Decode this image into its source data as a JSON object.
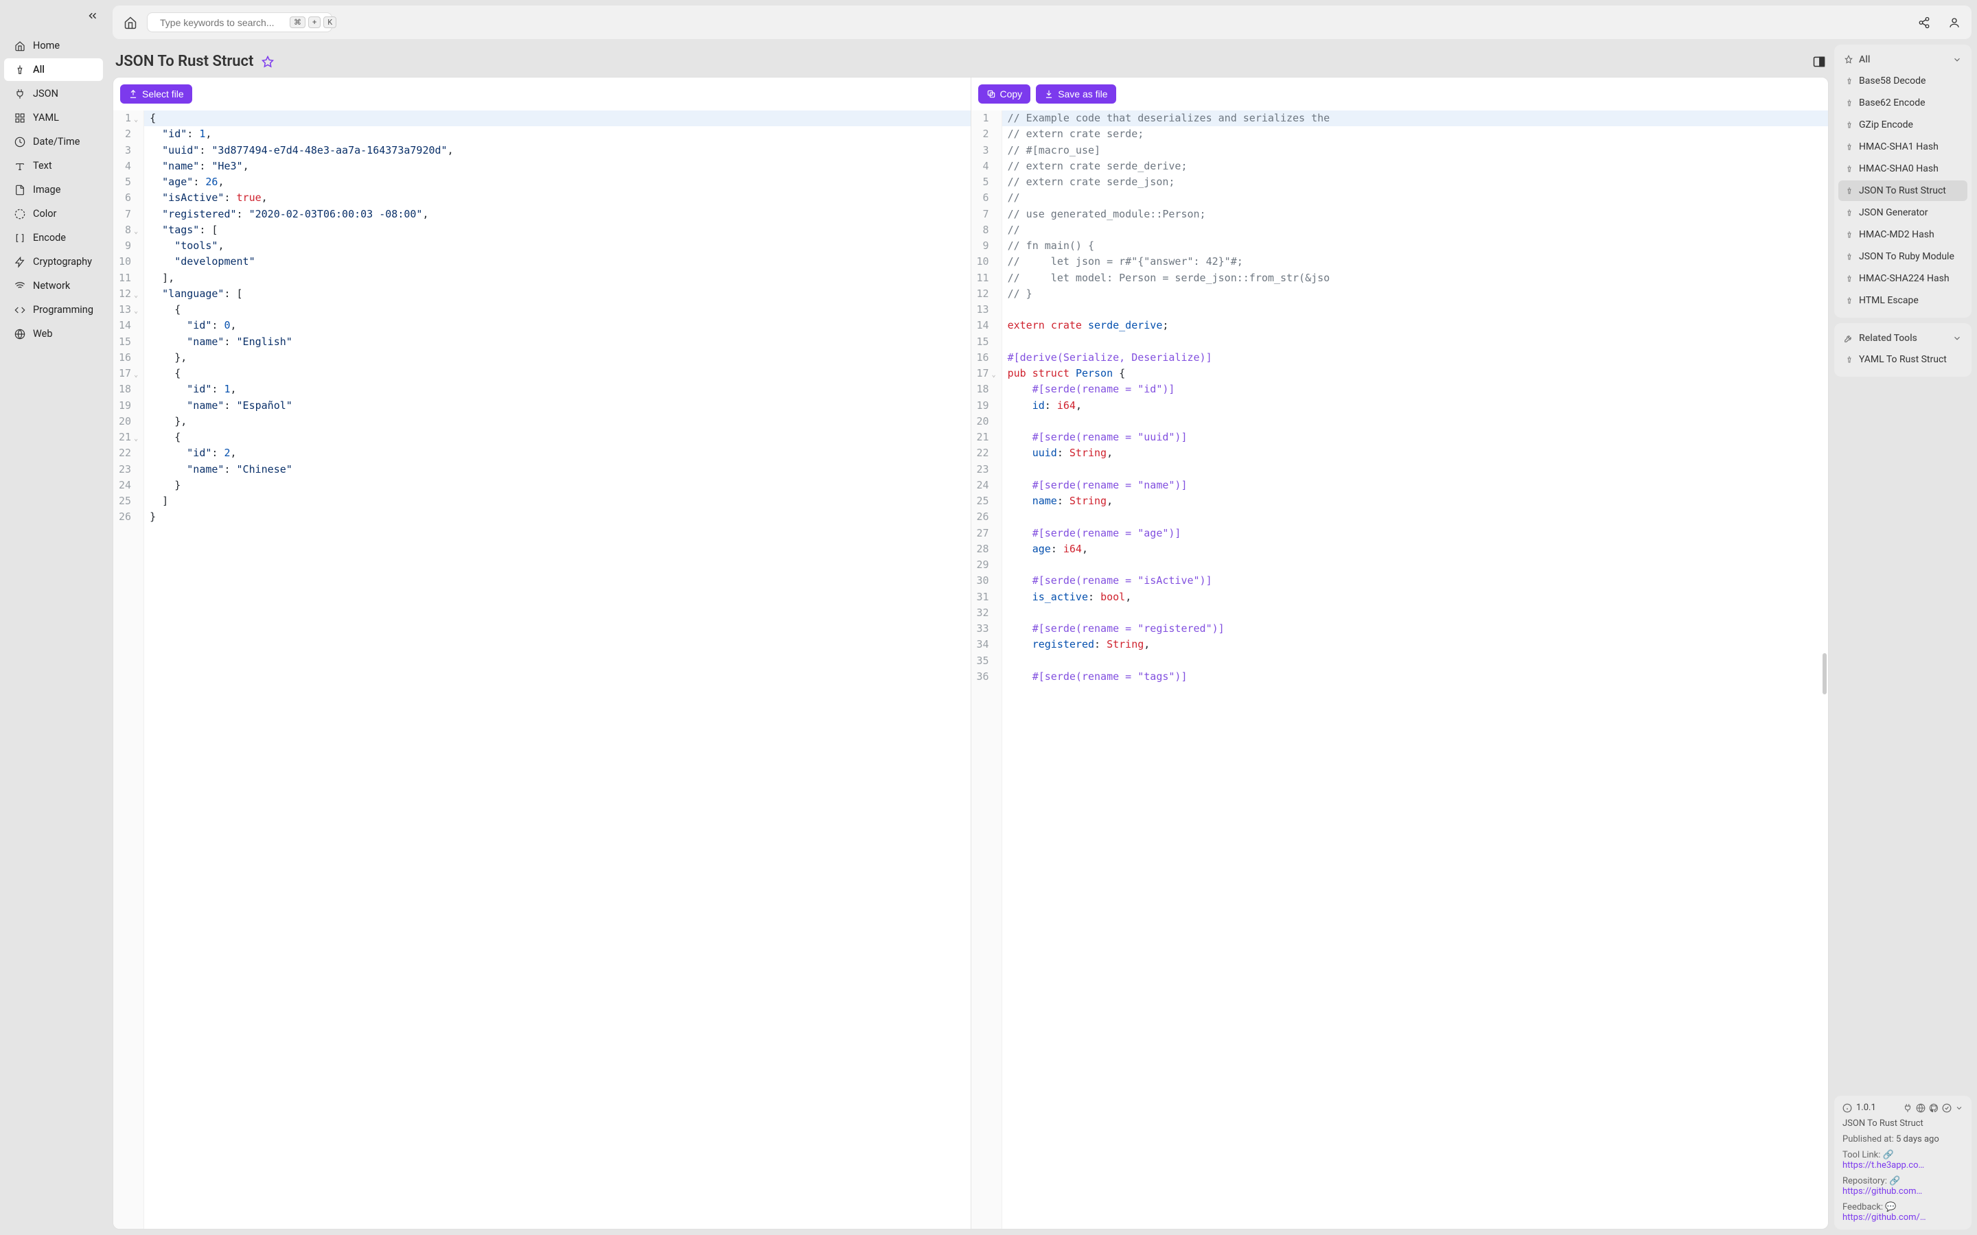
{
  "sidebar": {
    "items": [
      {
        "label": "Home",
        "icon": "home"
      },
      {
        "label": "All",
        "icon": "pin",
        "active": true
      },
      {
        "label": "JSON",
        "icon": "plug"
      },
      {
        "label": "YAML",
        "icon": "grid"
      },
      {
        "label": "Date/Time",
        "icon": "clock"
      },
      {
        "label": "Text",
        "icon": "text"
      },
      {
        "label": "Image",
        "icon": "file"
      },
      {
        "label": "Color",
        "icon": "circle-dash"
      },
      {
        "label": "Encode",
        "icon": "brackets"
      },
      {
        "label": "Cryptography",
        "icon": "bolt"
      },
      {
        "label": "Network",
        "icon": "wifi"
      },
      {
        "label": "Programming",
        "icon": "code"
      },
      {
        "label": "Web",
        "icon": "globe"
      }
    ]
  },
  "search": {
    "placeholder": "Type keywords to search...",
    "kbd1": "⌘",
    "kbdplus": "+",
    "kbd2": "K"
  },
  "page": {
    "title": "JSON To Rust Struct"
  },
  "actions": {
    "select_file": "Select file",
    "copy": "Copy",
    "save_as_file": "Save as file"
  },
  "input_json": {
    "lines": [
      {
        "n": 1,
        "fold": true,
        "tokens": [
          {
            "t": "{",
            "c": "punc"
          }
        ],
        "hl": true
      },
      {
        "n": 2,
        "tokens": [
          {
            "t": "  ",
            "c": ""
          },
          {
            "t": "\"id\"",
            "c": "key"
          },
          {
            "t": ": ",
            "c": "punc"
          },
          {
            "t": "1",
            "c": "num"
          },
          {
            "t": ",",
            "c": "punc"
          }
        ]
      },
      {
        "n": 3,
        "tokens": [
          {
            "t": "  ",
            "c": ""
          },
          {
            "t": "\"uuid\"",
            "c": "key"
          },
          {
            "t": ": ",
            "c": "punc"
          },
          {
            "t": "\"3d877494-e7d4-48e3-aa7a-164373a7920d\"",
            "c": "str"
          },
          {
            "t": ",",
            "c": "punc"
          }
        ]
      },
      {
        "n": 4,
        "tokens": [
          {
            "t": "  ",
            "c": ""
          },
          {
            "t": "\"name\"",
            "c": "key"
          },
          {
            "t": ": ",
            "c": "punc"
          },
          {
            "t": "\"He3\"",
            "c": "str"
          },
          {
            "t": ",",
            "c": "punc"
          }
        ]
      },
      {
        "n": 5,
        "tokens": [
          {
            "t": "  ",
            "c": ""
          },
          {
            "t": "\"age\"",
            "c": "key"
          },
          {
            "t": ": ",
            "c": "punc"
          },
          {
            "t": "26",
            "c": "num"
          },
          {
            "t": ",",
            "c": "punc"
          }
        ]
      },
      {
        "n": 6,
        "tokens": [
          {
            "t": "  ",
            "c": ""
          },
          {
            "t": "\"isActive\"",
            "c": "key"
          },
          {
            "t": ": ",
            "c": "punc"
          },
          {
            "t": "true",
            "c": "bool"
          },
          {
            "t": ",",
            "c": "punc"
          }
        ]
      },
      {
        "n": 7,
        "tokens": [
          {
            "t": "  ",
            "c": ""
          },
          {
            "t": "\"registered\"",
            "c": "key"
          },
          {
            "t": ": ",
            "c": "punc"
          },
          {
            "t": "\"2020-02-03T06:00:03 -08:00\"",
            "c": "str"
          },
          {
            "t": ",",
            "c": "punc"
          }
        ]
      },
      {
        "n": 8,
        "fold": true,
        "tokens": [
          {
            "t": "  ",
            "c": ""
          },
          {
            "t": "\"tags\"",
            "c": "key"
          },
          {
            "t": ": [",
            "c": "punc"
          }
        ]
      },
      {
        "n": 9,
        "tokens": [
          {
            "t": "    ",
            "c": ""
          },
          {
            "t": "\"tools\"",
            "c": "str"
          },
          {
            "t": ",",
            "c": "punc"
          }
        ]
      },
      {
        "n": 10,
        "tokens": [
          {
            "t": "    ",
            "c": ""
          },
          {
            "t": "\"development\"",
            "c": "str"
          }
        ]
      },
      {
        "n": 11,
        "tokens": [
          {
            "t": "  ],",
            "c": "punc"
          }
        ]
      },
      {
        "n": 12,
        "fold": true,
        "tokens": [
          {
            "t": "  ",
            "c": ""
          },
          {
            "t": "\"language\"",
            "c": "key"
          },
          {
            "t": ": [",
            "c": "punc"
          }
        ]
      },
      {
        "n": 13,
        "fold": true,
        "tokens": [
          {
            "t": "    {",
            "c": "punc"
          }
        ]
      },
      {
        "n": 14,
        "tokens": [
          {
            "t": "      ",
            "c": ""
          },
          {
            "t": "\"id\"",
            "c": "key"
          },
          {
            "t": ": ",
            "c": "punc"
          },
          {
            "t": "0",
            "c": "num"
          },
          {
            "t": ",",
            "c": "punc"
          }
        ]
      },
      {
        "n": 15,
        "tokens": [
          {
            "t": "      ",
            "c": ""
          },
          {
            "t": "\"name\"",
            "c": "key"
          },
          {
            "t": ": ",
            "c": "punc"
          },
          {
            "t": "\"English\"",
            "c": "str"
          }
        ]
      },
      {
        "n": 16,
        "tokens": [
          {
            "t": "    },",
            "c": "punc"
          }
        ]
      },
      {
        "n": 17,
        "fold": true,
        "tokens": [
          {
            "t": "    {",
            "c": "punc"
          }
        ]
      },
      {
        "n": 18,
        "tokens": [
          {
            "t": "      ",
            "c": ""
          },
          {
            "t": "\"id\"",
            "c": "key"
          },
          {
            "t": ": ",
            "c": "punc"
          },
          {
            "t": "1",
            "c": "num"
          },
          {
            "t": ",",
            "c": "punc"
          }
        ]
      },
      {
        "n": 19,
        "tokens": [
          {
            "t": "      ",
            "c": ""
          },
          {
            "t": "\"name\"",
            "c": "key"
          },
          {
            "t": ": ",
            "c": "punc"
          },
          {
            "t": "\"Español\"",
            "c": "str"
          }
        ]
      },
      {
        "n": 20,
        "tokens": [
          {
            "t": "    },",
            "c": "punc"
          }
        ]
      },
      {
        "n": 21,
        "fold": true,
        "tokens": [
          {
            "t": "    {",
            "c": "punc"
          }
        ]
      },
      {
        "n": 22,
        "tokens": [
          {
            "t": "      ",
            "c": ""
          },
          {
            "t": "\"id\"",
            "c": "key"
          },
          {
            "t": ": ",
            "c": "punc"
          },
          {
            "t": "2",
            "c": "num"
          },
          {
            "t": ",",
            "c": "punc"
          }
        ]
      },
      {
        "n": 23,
        "tokens": [
          {
            "t": "      ",
            "c": ""
          },
          {
            "t": "\"name\"",
            "c": "key"
          },
          {
            "t": ": ",
            "c": "punc"
          },
          {
            "t": "\"Chinese\"",
            "c": "str"
          }
        ]
      },
      {
        "n": 24,
        "tokens": [
          {
            "t": "    }",
            "c": "punc"
          }
        ]
      },
      {
        "n": 25,
        "tokens": [
          {
            "t": "  ]",
            "c": "punc"
          }
        ]
      },
      {
        "n": 26,
        "tokens": [
          {
            "t": "}",
            "c": "punc"
          }
        ],
        "hl2": true
      }
    ]
  },
  "output_rust": {
    "lines": [
      {
        "n": 1,
        "tokens": [
          {
            "t": "// Example code that deserializes and serializes the",
            "c": "comment"
          }
        ],
        "hl": true
      },
      {
        "n": 2,
        "tokens": [
          {
            "t": "// extern crate serde;",
            "c": "comment"
          }
        ]
      },
      {
        "n": 3,
        "tokens": [
          {
            "t": "// #[macro_use]",
            "c": "comment"
          }
        ]
      },
      {
        "n": 4,
        "tokens": [
          {
            "t": "// extern crate serde_derive;",
            "c": "comment"
          }
        ]
      },
      {
        "n": 5,
        "tokens": [
          {
            "t": "// extern crate serde_json;",
            "c": "comment"
          }
        ]
      },
      {
        "n": 6,
        "tokens": [
          {
            "t": "//",
            "c": "comment"
          }
        ]
      },
      {
        "n": 7,
        "tokens": [
          {
            "t": "// use generated_module::Person;",
            "c": "comment"
          }
        ]
      },
      {
        "n": 8,
        "tokens": [
          {
            "t": "//",
            "c": "comment"
          }
        ]
      },
      {
        "n": 9,
        "tokens": [
          {
            "t": "// fn main() {",
            "c": "comment"
          }
        ]
      },
      {
        "n": 10,
        "tokens": [
          {
            "t": "//     let json = r#\"{\"answer\": 42}\"#;",
            "c": "comment"
          }
        ]
      },
      {
        "n": 11,
        "tokens": [
          {
            "t": "//     let model: Person = serde_json::from_str(&jso",
            "c": "comment"
          }
        ]
      },
      {
        "n": 12,
        "tokens": [
          {
            "t": "// }",
            "c": "comment"
          }
        ]
      },
      {
        "n": 13,
        "tokens": [
          {
            "t": "",
            "c": ""
          }
        ]
      },
      {
        "n": 14,
        "tokens": [
          {
            "t": "extern",
            "c": "kw"
          },
          {
            "t": " ",
            "c": ""
          },
          {
            "t": "crate",
            "c": "kw"
          },
          {
            "t": " ",
            "c": ""
          },
          {
            "t": "serde_derive",
            "c": "ident"
          },
          {
            "t": ";",
            "c": "punc"
          }
        ]
      },
      {
        "n": 15,
        "tokens": [
          {
            "t": "",
            "c": ""
          }
        ]
      },
      {
        "n": 16,
        "tokens": [
          {
            "t": "#[derive(Serialize, Deserialize)]",
            "c": "kw2"
          }
        ]
      },
      {
        "n": 17,
        "fold": true,
        "tokens": [
          {
            "t": "pub",
            "c": "kw"
          },
          {
            "t": " ",
            "c": ""
          },
          {
            "t": "struct",
            "c": "kw"
          },
          {
            "t": " ",
            "c": ""
          },
          {
            "t": "Person",
            "c": "ident"
          },
          {
            "t": " {",
            "c": "punc"
          }
        ]
      },
      {
        "n": 18,
        "tokens": [
          {
            "t": "    #[serde(rename = \"id\")]",
            "c": "kw2"
          }
        ]
      },
      {
        "n": 19,
        "tokens": [
          {
            "t": "    ",
            "c": ""
          },
          {
            "t": "id",
            "c": "field"
          },
          {
            "t": ": ",
            "c": "punc"
          },
          {
            "t": "i64",
            "c": "type"
          },
          {
            "t": ",",
            "c": "punc"
          }
        ]
      },
      {
        "n": 20,
        "tokens": [
          {
            "t": "",
            "c": ""
          }
        ]
      },
      {
        "n": 21,
        "tokens": [
          {
            "t": "    #[serde(rename = \"uuid\")]",
            "c": "kw2"
          }
        ]
      },
      {
        "n": 22,
        "tokens": [
          {
            "t": "    ",
            "c": ""
          },
          {
            "t": "uuid",
            "c": "field"
          },
          {
            "t": ": ",
            "c": "punc"
          },
          {
            "t": "String",
            "c": "type"
          },
          {
            "t": ",",
            "c": "punc"
          }
        ]
      },
      {
        "n": 23,
        "tokens": [
          {
            "t": "",
            "c": ""
          }
        ]
      },
      {
        "n": 24,
        "tokens": [
          {
            "t": "    #[serde(rename = \"name\")]",
            "c": "kw2"
          }
        ]
      },
      {
        "n": 25,
        "tokens": [
          {
            "t": "    ",
            "c": ""
          },
          {
            "t": "name",
            "c": "field"
          },
          {
            "t": ": ",
            "c": "punc"
          },
          {
            "t": "String",
            "c": "type"
          },
          {
            "t": ",",
            "c": "punc"
          }
        ]
      },
      {
        "n": 26,
        "tokens": [
          {
            "t": "",
            "c": ""
          }
        ]
      },
      {
        "n": 27,
        "tokens": [
          {
            "t": "    #[serde(rename = \"age\")]",
            "c": "kw2"
          }
        ]
      },
      {
        "n": 28,
        "tokens": [
          {
            "t": "    ",
            "c": ""
          },
          {
            "t": "age",
            "c": "field"
          },
          {
            "t": ": ",
            "c": "punc"
          },
          {
            "t": "i64",
            "c": "type"
          },
          {
            "t": ",",
            "c": "punc"
          }
        ]
      },
      {
        "n": 29,
        "tokens": [
          {
            "t": "",
            "c": ""
          }
        ]
      },
      {
        "n": 30,
        "tokens": [
          {
            "t": "    #[serde(rename = \"isActive\")]",
            "c": "kw2"
          }
        ]
      },
      {
        "n": 31,
        "tokens": [
          {
            "t": "    ",
            "c": ""
          },
          {
            "t": "is_active",
            "c": "field"
          },
          {
            "t": ": ",
            "c": "punc"
          },
          {
            "t": "bool",
            "c": "type"
          },
          {
            "t": ",",
            "c": "punc"
          }
        ]
      },
      {
        "n": 32,
        "tokens": [
          {
            "t": "",
            "c": ""
          }
        ]
      },
      {
        "n": 33,
        "tokens": [
          {
            "t": "    #[serde(rename = \"registered\")]",
            "c": "kw2"
          }
        ]
      },
      {
        "n": 34,
        "tokens": [
          {
            "t": "    ",
            "c": ""
          },
          {
            "t": "registered",
            "c": "field"
          },
          {
            "t": ": ",
            "c": "punc"
          },
          {
            "t": "String",
            "c": "type"
          },
          {
            "t": ",",
            "c": "punc"
          }
        ]
      },
      {
        "n": 35,
        "tokens": [
          {
            "t": "",
            "c": ""
          }
        ]
      },
      {
        "n": 36,
        "tokens": [
          {
            "t": "    #[serde(rename = \"tags\")]",
            "c": "kw2"
          }
        ]
      }
    ]
  },
  "filter": {
    "label": "All",
    "items": [
      {
        "label": "Base58 Decode"
      },
      {
        "label": "Base62 Encode"
      },
      {
        "label": "GZip Encode"
      },
      {
        "label": "HMAC-SHA1 Hash"
      },
      {
        "label": "HMAC-SHA0 Hash"
      },
      {
        "label": "JSON To Rust Struct",
        "active": true
      },
      {
        "label": "JSON Generator"
      },
      {
        "label": "HMAC-MD2 Hash"
      },
      {
        "label": "JSON To Ruby Module"
      },
      {
        "label": "HMAC-SHA224 Hash"
      },
      {
        "label": "HTML Escape"
      }
    ]
  },
  "related": {
    "label": "Related Tools",
    "items": [
      {
        "label": "YAML To Rust Struct"
      }
    ]
  },
  "info": {
    "version": "1.0.1",
    "title": "JSON To Rust Struct",
    "published_label": "Published at:",
    "published": "5 days ago",
    "tool_link_label": "Tool Link:",
    "tool_link": "https://t.he3app.co…",
    "repo_label": "Repository:",
    "repo": "https://github.com…",
    "feedback_label": "Feedback:",
    "feedback": "https://github.com/…"
  }
}
